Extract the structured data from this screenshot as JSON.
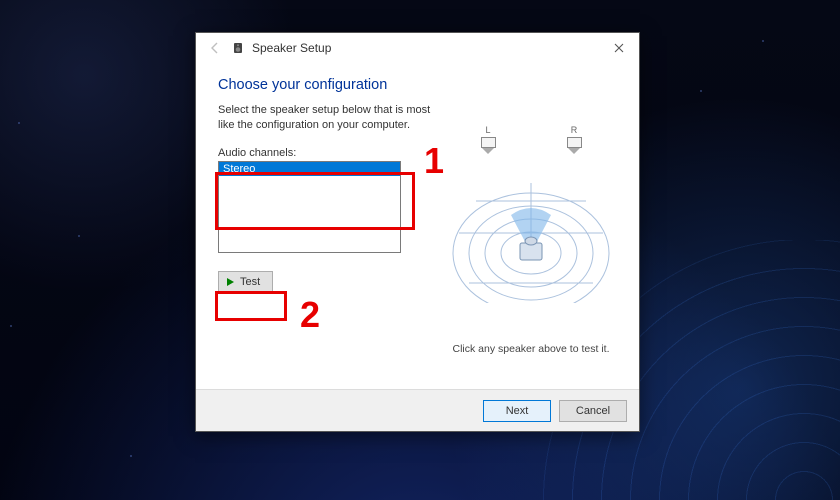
{
  "titlebar": {
    "title": "Speaker Setup"
  },
  "heading": "Choose your configuration",
  "subtext": "Select the speaker setup below that is most like the configuration on your computer.",
  "channels": {
    "label": "Audio channels:",
    "options": [
      "Stereo"
    ],
    "selected": "Stereo"
  },
  "buttons": {
    "test": "Test",
    "next": "Next",
    "cancel": "Cancel"
  },
  "diagram": {
    "left_label": "L",
    "right_label": "R",
    "hint": "Click any speaker above to test it."
  },
  "annotations": {
    "num1": "1",
    "num2": "2"
  }
}
